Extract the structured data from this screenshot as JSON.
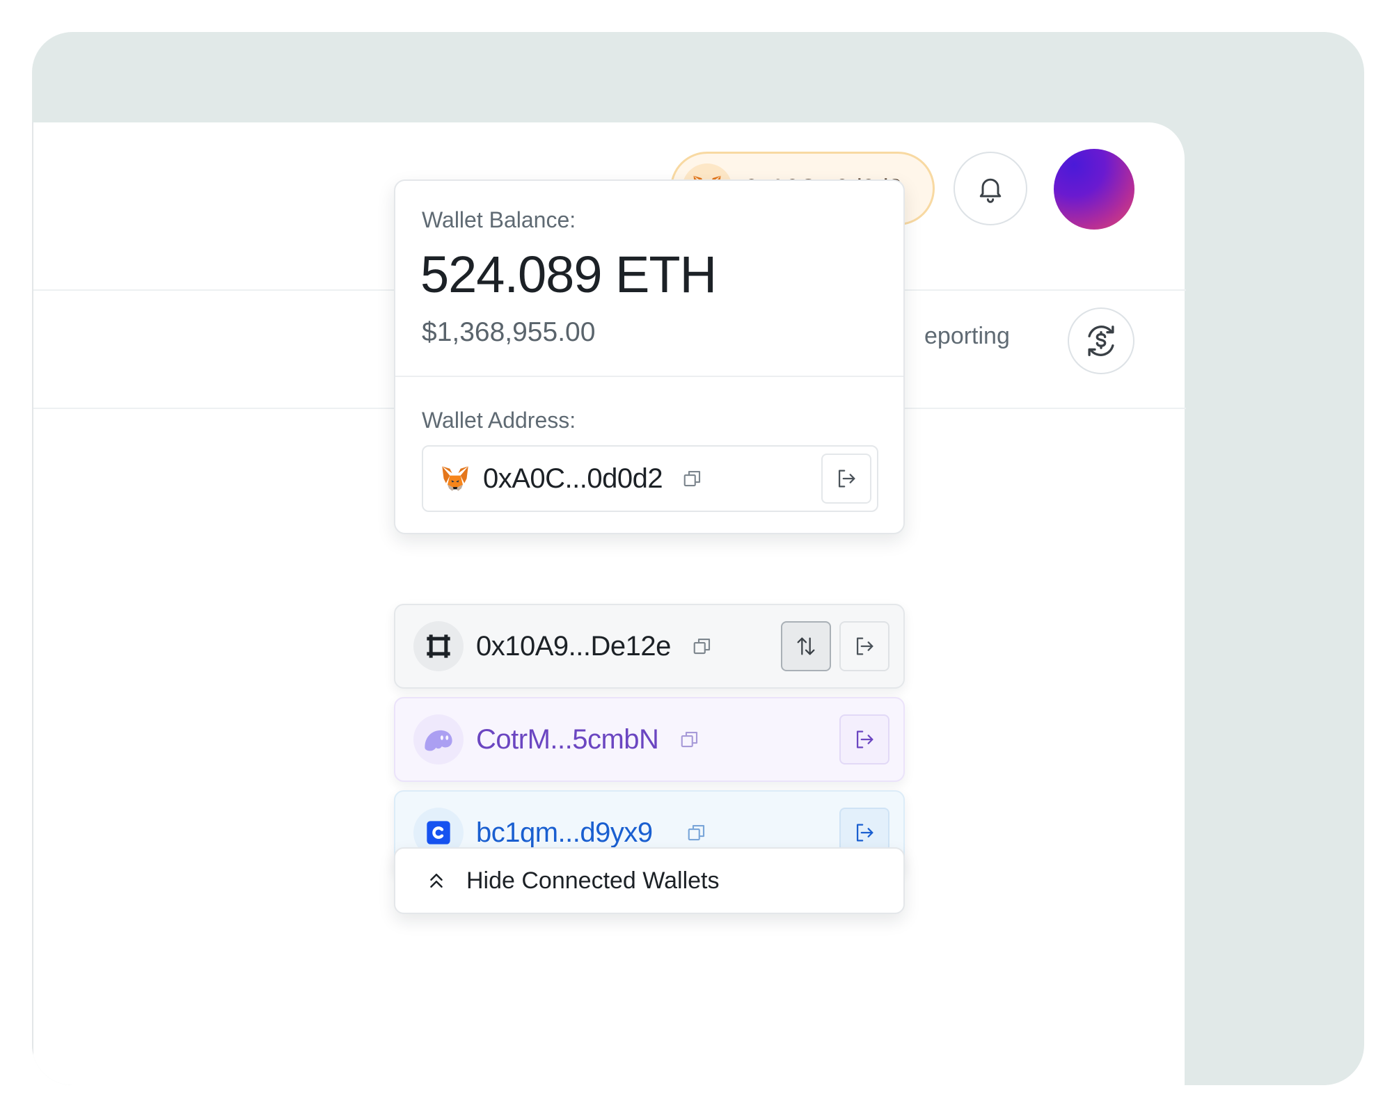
{
  "header": {
    "connected_wallet": {
      "address": "0xA0C...0d0d2",
      "icon": "metamask-fox-icon"
    },
    "notifications": {
      "icon": "bell-icon"
    },
    "avatar": {
      "gradient": [
        "#4a1ad8",
        "#e24a6e"
      ]
    }
  },
  "subnav": {
    "reporting_label": "eporting",
    "currency_icon": "dollar-sync-icon"
  },
  "wallet_dropdown": {
    "balance_label": "Wallet Balance:",
    "balance_eth": "524.089 ETH",
    "balance_usd": "$1,368,955.00",
    "address_label": "Wallet Address:",
    "primary_wallet": {
      "address": "0xA0C...0d0d2",
      "icon": "metamask-fox-icon"
    },
    "connected_wallets": [
      {
        "address": "0x10A9...De12e",
        "icon": "frame-wallet-icon",
        "color": "#1c2126",
        "background": "#f6f7f8",
        "actions": [
          "switch",
          "disconnect"
        ]
      },
      {
        "address": "CotrM...5cmbN",
        "icon": "phantom-ghost-icon",
        "color": "#6b46c1",
        "background": "#f8f5fe",
        "actions": [
          "disconnect"
        ]
      },
      {
        "address": "bc1qm...d9yx9",
        "icon": "coinbase-icon",
        "color": "#1a5fd0",
        "background": "#f1f8fd",
        "actions": [
          "disconnect"
        ]
      }
    ],
    "hide_wallets_label": "Hide Connected Wallets"
  },
  "colors": {
    "frame_background": "#e1e9e8",
    "pill_background": "#fff6ea",
    "pill_border": "#f8d9a2"
  }
}
